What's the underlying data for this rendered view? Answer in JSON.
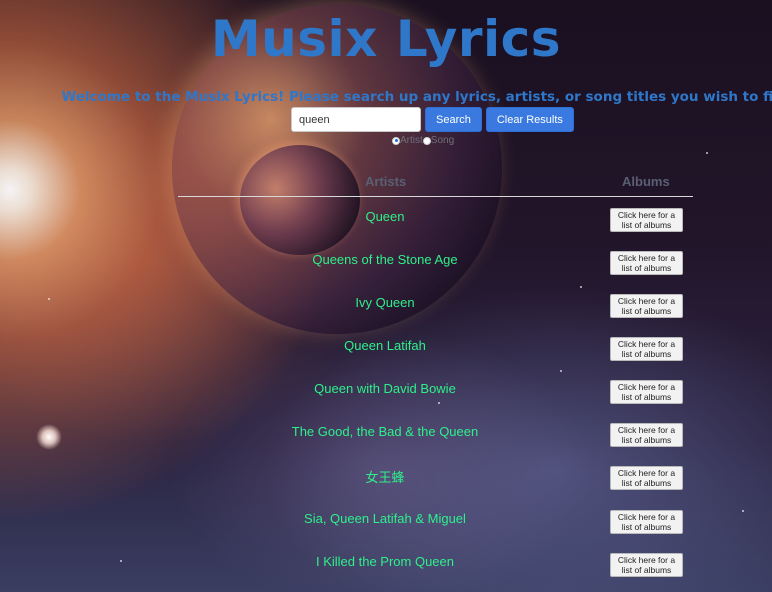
{
  "app": {
    "title": "Musix Lyrics",
    "welcome": "Welcome to the Musix Lyrics! Please search up any lyrics, artists, or song titles you wish to find!"
  },
  "search": {
    "value": "queen",
    "search_label": "Search",
    "clear_label": "Clear Results",
    "options": [
      {
        "label": "Artist",
        "selected": true
      },
      {
        "label": "Song",
        "selected": false
      }
    ]
  },
  "table": {
    "headers": {
      "artists": "Artists",
      "albums": "Albums"
    },
    "album_button_label": "Click here for a list of albums",
    "rows": [
      {
        "artist": "Queen"
      },
      {
        "artist": "Queens of the Stone Age"
      },
      {
        "artist": "Ivy Queen"
      },
      {
        "artist": "Queen Latifah"
      },
      {
        "artist": "Queen with David Bowie"
      },
      {
        "artist": "The Good, the Bad & the Queen"
      },
      {
        "artist": "女王蜂"
      },
      {
        "artist": "Sia, Queen Latifah & Miguel"
      },
      {
        "artist": "I Killed the Prom Queen"
      }
    ]
  },
  "colors": {
    "title": "#2f77c9",
    "artist_text": "#2ef08a",
    "button": "#3a7ae0"
  }
}
